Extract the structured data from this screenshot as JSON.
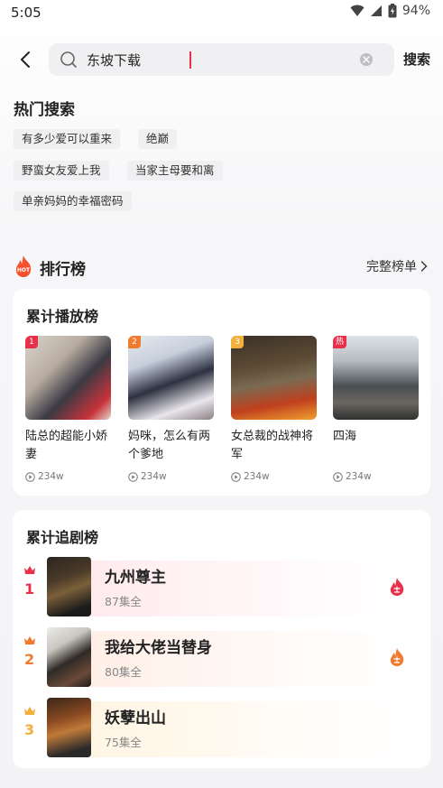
{
  "status": {
    "time": "5:05",
    "battery": "94%"
  },
  "search": {
    "value": "东坡下载",
    "button": "搜索"
  },
  "hot": {
    "title": "热门搜索",
    "tags": [
      "有多少爱可以重来",
      "绝巅",
      "野蛮女友爱上我",
      "当家主母要和离",
      "单亲妈妈的幸福密码"
    ]
  },
  "ranking": {
    "title": "排行榜",
    "badge": "HOT",
    "full_list": "完整榜单",
    "play": {
      "title": "累计播放榜",
      "items": [
        {
          "rank": "1",
          "name": "陆总的超能小娇妻",
          "count": "234w",
          "badge_color": "#e8304a"
        },
        {
          "rank": "2",
          "name": "妈咪，怎么有两个爹地",
          "count": "234w",
          "badge_color": "#f07a2e"
        },
        {
          "rank": "3",
          "name": "女总裁的战神将军",
          "count": "234w",
          "badge_color": "#f2b13c"
        },
        {
          "rank": "热",
          "name": "四海",
          "count": "234w",
          "badge_color": "#e8304a"
        }
      ]
    },
    "follow": {
      "title": "累计追剧榜",
      "items": [
        {
          "rank": "1",
          "name": "九州尊主",
          "eps": "87集全",
          "color": "#e8304a"
        },
        {
          "rank": "2",
          "name": "我给大佬当替身",
          "eps": "80集全",
          "color": "#f07a2e"
        },
        {
          "rank": "3",
          "name": "妖孽出山",
          "eps": "75集全",
          "color": "#f2b13c"
        }
      ]
    }
  }
}
